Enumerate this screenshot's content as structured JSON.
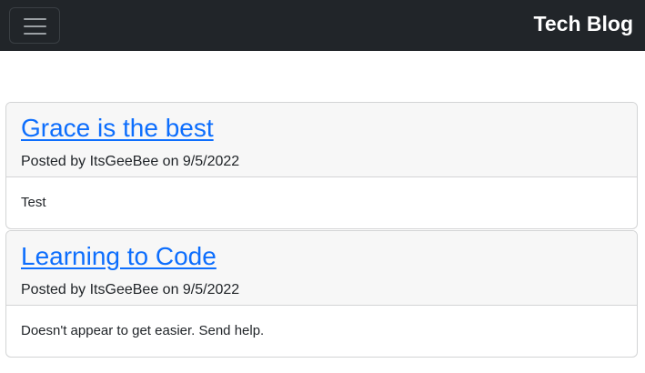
{
  "navbar": {
    "brand": "Tech Blog",
    "toggler_icon": "hamburger-menu-icon"
  },
  "posts": [
    {
      "title": "Grace is the best",
      "meta_prefix": "Posted by ",
      "author": "ItsGeeBee",
      "meta_mid": " on ",
      "date": "9/5/2022",
      "body": "Test"
    },
    {
      "title": "Learning to Code",
      "meta_prefix": "Posted by ",
      "author": "ItsGeeBee",
      "meta_mid": " on ",
      "date": "9/5/2022",
      "body": "Doesn't appear to get easier. Send help."
    }
  ],
  "colors": {
    "navbar_bg": "#212529",
    "link": "#0d6efd",
    "card_header_bg": "#f7f7f7"
  }
}
